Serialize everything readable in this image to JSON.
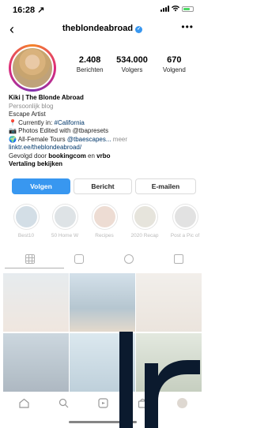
{
  "status_bar": {
    "time": "16:28 ↗"
  },
  "nav": {
    "username": "theblondeabroad",
    "verified_mark": "✓",
    "back_glyph": "‹",
    "more_glyph": "•••"
  },
  "stats": [
    {
      "value": "2.408",
      "label": "Berichten"
    },
    {
      "value": "534.000",
      "label": "Volgers"
    },
    {
      "value": "670",
      "label": "Volgend"
    }
  ],
  "bio": {
    "name": "Kiki | The Blonde Abroad",
    "category": "Persoonlijk blog",
    "line1": "Escape Artist",
    "line2_prefix": "📍 Currently in: ",
    "line2_tag": "#California",
    "line3": "📷 Photos Edited with @tbapresets",
    "line4_prefix": "🌍 All-Female Tours ",
    "line4_tag": "@tbaescapes...",
    "line4_more": " meer",
    "link": "linktr.ee/theblondeabroad/",
    "followed_prefix": "Gevolgd door ",
    "followed_a": "bookingcom",
    "followed_mid": " en ",
    "followed_b": "vrbo",
    "translate": "Vertaling bekijken"
  },
  "actions": {
    "follow": "Volgen",
    "message": "Bericht",
    "email": "E-mailen"
  },
  "highlights": [
    {
      "label": "Best10"
    },
    {
      "label": "50 Home W"
    },
    {
      "label": "Recipes"
    },
    {
      "label": "2020 Recap"
    },
    {
      "label": "Post a Pic of"
    }
  ],
  "overlay_text": "lr",
  "colors": {
    "accent": "#3897f0",
    "link": "#00376b",
    "overlay": "#0b1a2e"
  }
}
